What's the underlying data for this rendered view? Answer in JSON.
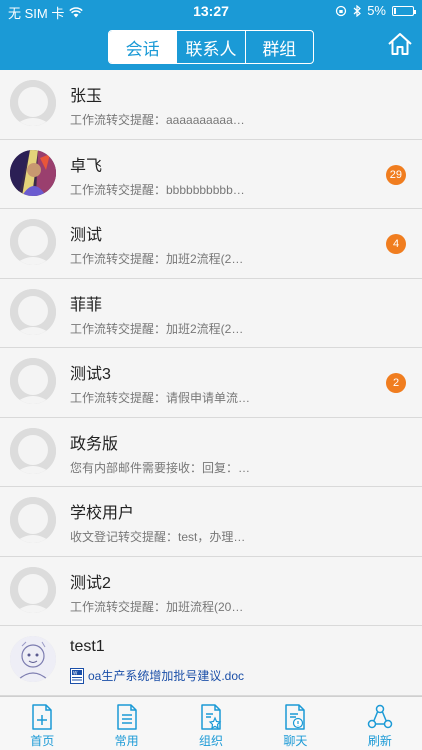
{
  "status_bar": {
    "carrier": "无 SIM 卡",
    "time": "13:27",
    "battery": "5%"
  },
  "header": {
    "tabs": [
      {
        "label": "会话",
        "active": true
      },
      {
        "label": "联系人",
        "active": false
      },
      {
        "label": "群组",
        "active": false
      }
    ],
    "home_icon": "home-icon"
  },
  "conversations": [
    {
      "name": "张玉",
      "preview": "工作流转交提醒：aaaaaaaaaa…",
      "badge": null,
      "avatar": "default"
    },
    {
      "name": "卓飞",
      "preview": "工作流转交提醒：bbbbbbbbbb…",
      "badge": "29",
      "avatar": "photo"
    },
    {
      "name": "测试",
      "preview": "工作流转交提醒：加班2流程(2…",
      "badge": "4",
      "avatar": "default"
    },
    {
      "name": "菲菲",
      "preview": "工作流转交提醒：加班2流程(2…",
      "badge": null,
      "avatar": "default"
    },
    {
      "name": "测试3",
      "preview": "工作流转交提醒：请假申请单流…",
      "badge": "2",
      "avatar": "default"
    },
    {
      "name": "政务版",
      "preview": "您有内部邮件需要接收：回复：…",
      "badge": null,
      "avatar": "default"
    },
    {
      "name": "学校用户",
      "preview": "收文登记转交提醒：test，办理…",
      "badge": null,
      "avatar": "default"
    },
    {
      "name": "测试2",
      "preview": "工作流转交提醒：加班流程(201…",
      "badge": null,
      "avatar": "default"
    },
    {
      "name": "test1",
      "attachment": "oa生产系统增加批号建议.doc",
      "badge": null,
      "avatar": "sketch"
    }
  ],
  "tab_bar": [
    {
      "label": "首页",
      "icon": "home-doc-icon"
    },
    {
      "label": "常用",
      "icon": "doc-list-icon"
    },
    {
      "label": "组织",
      "icon": "doc-star-icon"
    },
    {
      "label": "聊天",
      "icon": "doc-chat-icon"
    },
    {
      "label": "刷新",
      "icon": "refresh-icon"
    }
  ],
  "colors": {
    "primary": "#1b9ad6",
    "badge": "#f07d1f",
    "attachment_link": "#1b4fa8"
  }
}
